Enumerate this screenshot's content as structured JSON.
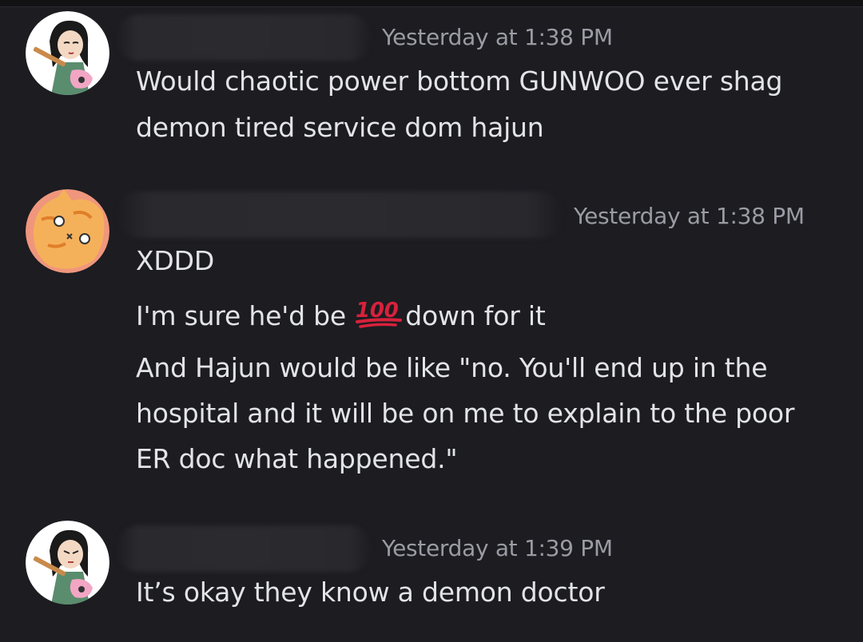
{
  "messages": [
    {
      "avatar": "girl-with-guitar-avatar",
      "timestamp": "Yesterday at 1:38 PM",
      "lines": [
        "Would chaotic power bottom GUNWOO ever shag",
        "demon tired service dom hajun"
      ]
    },
    {
      "avatar": "orange-cat-avatar",
      "timestamp": "Yesterday at 1:38 PM",
      "lines": [
        "XDDD",
        "I'm sure he'd be",
        "down for it",
        "And Hajun would be like \"no. You'll end up in the",
        "hospital and it will be on me to explain to the poor",
        "ER doc what happened.\""
      ],
      "emoji": "100"
    },
    {
      "avatar": "girl-with-guitar-avatar",
      "timestamp": "Yesterday at 1:39 PM",
      "lines": [
        "It’s okay they know a demon doctor"
      ]
    }
  ],
  "colors": {
    "background": "#1c1c21",
    "text": "#e3e4e7",
    "timestamp": "#9a9ba3",
    "emoji_red": "#d8213b"
  }
}
